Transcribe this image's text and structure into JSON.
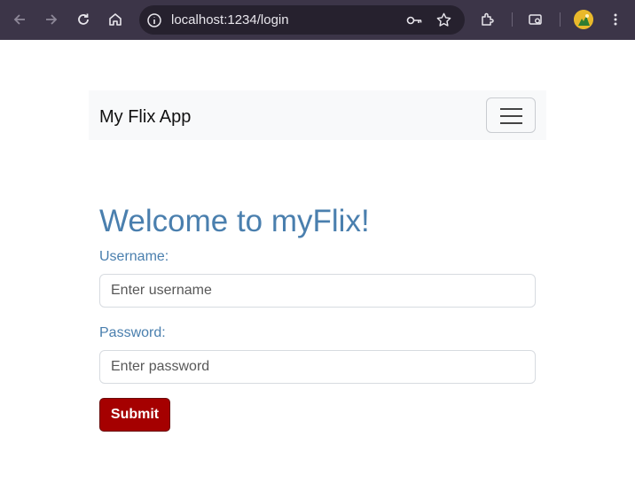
{
  "browser": {
    "url": "localhost:1234/login",
    "icons": [
      "back-icon",
      "forward-icon",
      "reload-icon",
      "home-icon",
      "info-icon",
      "key-icon",
      "star-icon",
      "extensions-icon",
      "search-tabs-icon",
      "avatar",
      "more-icon"
    ]
  },
  "navbar": {
    "brand": "My Flix App"
  },
  "login": {
    "title": "Welcome to myFlix!",
    "username_label": "Username:",
    "username_placeholder": "Enter username",
    "username_value": "",
    "password_label": "Password:",
    "password_placeholder": "Enter password",
    "password_value": "",
    "submit_label": "Submit"
  },
  "colors": {
    "accent": "#4a7fae",
    "submit": "#a50000",
    "navbar_bg": "#f8f9fa",
    "chrome_bg": "#3c3548"
  }
}
